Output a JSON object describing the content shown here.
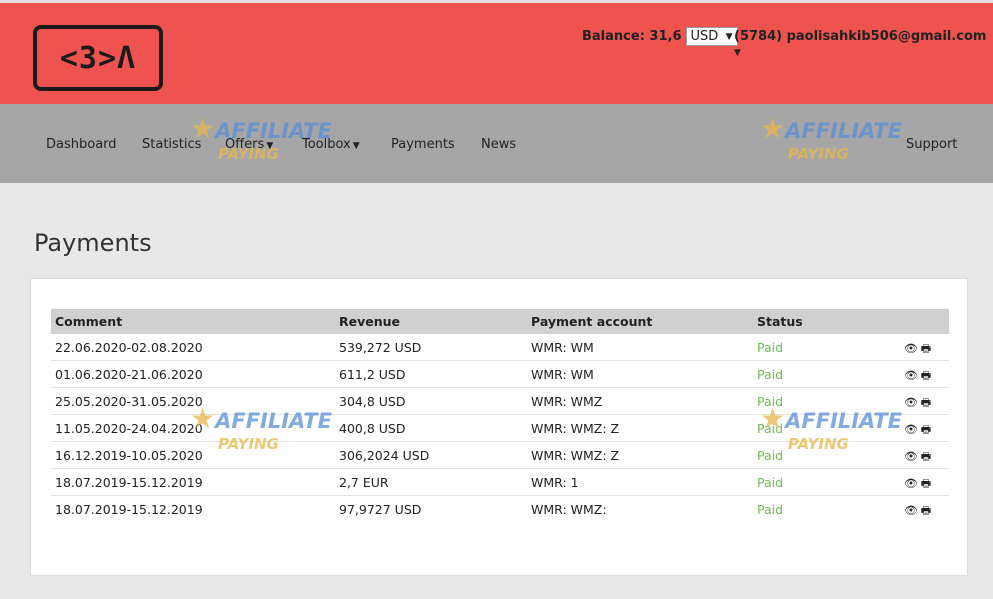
{
  "logo": {
    "text": "<3>Λ"
  },
  "header": {
    "balance_label": "Balance: 31,6",
    "currency": "USD",
    "account": "(5784) paolisahkib506@gmail.com"
  },
  "nav": {
    "dashboard": "Dashboard",
    "statistics": "Statistics",
    "offers": "Offers",
    "toolbox": "Toolbox",
    "payments": "Payments",
    "news": "News",
    "support": "Support"
  },
  "page": {
    "title": "Payments"
  },
  "table": {
    "headers": {
      "comment": "Comment",
      "revenue": "Revenue",
      "account": "Payment account",
      "status": "Status"
    },
    "rows": [
      {
        "comment": "22.06.2020-02.08.2020",
        "revenue": "539,272 USD",
        "account": "WMR: WM",
        "status": "Paid"
      },
      {
        "comment": "01.06.2020-21.06.2020",
        "revenue": "611,2 USD",
        "account": "WMR: WM",
        "status": "Paid"
      },
      {
        "comment": "25.05.2020-31.05.2020",
        "revenue": "304,8 USD",
        "account": "WMR: WMZ",
        "status": "Paid"
      },
      {
        "comment": "11.05.2020-24.04.2020",
        "revenue": "400,8 USD",
        "account": "WMR: WMZ: Z",
        "status": "Paid"
      },
      {
        "comment": "16.12.2019-10.05.2020",
        "revenue": "306,2024 USD",
        "account": "WMR: WMZ: Z",
        "status": "Paid"
      },
      {
        "comment": "18.07.2019-15.12.2019",
        "revenue": "2,7 EUR",
        "account": "WMR: 1",
        "status": "Paid"
      },
      {
        "comment": "18.07.2019-15.12.2019",
        "revenue": "97,9727 USD",
        "account": "WMR: WMZ:",
        "status": "Paid"
      }
    ]
  },
  "watermark": {
    "line1": "AFFILIATE",
    "line2": "PAYING"
  }
}
